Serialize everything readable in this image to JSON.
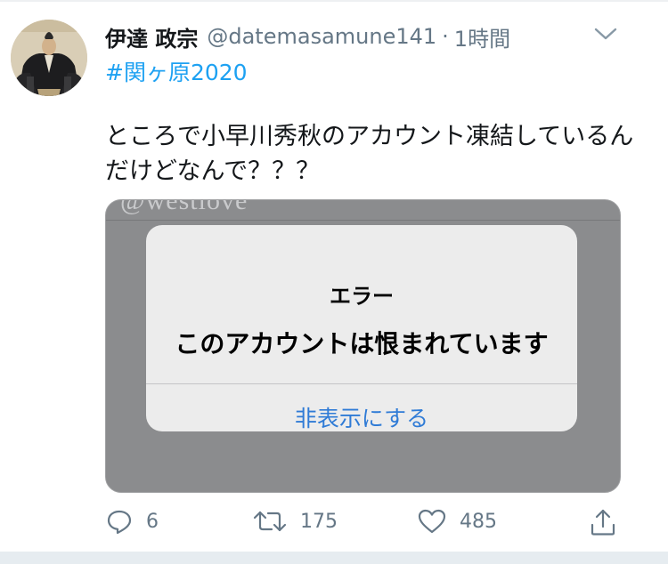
{
  "colors": {
    "link": "#1da1f2",
    "muted": "#657786",
    "alert_button": "#2f7bd6"
  },
  "tweet": {
    "avatar_icon": "samurai-portrait-avatar",
    "display_name": "伊達 政宗",
    "handle": "@datemasamune141",
    "separator": "·",
    "time": "1時間",
    "hashtag": "#関ヶ原2020",
    "text_lines": [
      "ところで小早川秀秋のアカウント凍結しているん",
      "だけどなんで？？？"
    ],
    "media": {
      "watermark": "@westlove",
      "alert": {
        "title": "エラー",
        "message": "このアカウントは恨まれています",
        "button": "非表示にする"
      }
    },
    "actions": {
      "replies": "6",
      "retweets": "175",
      "likes": "485",
      "icons": [
        "reply-icon",
        "retweet-icon",
        "like-icon",
        "share-icon"
      ]
    }
  }
}
